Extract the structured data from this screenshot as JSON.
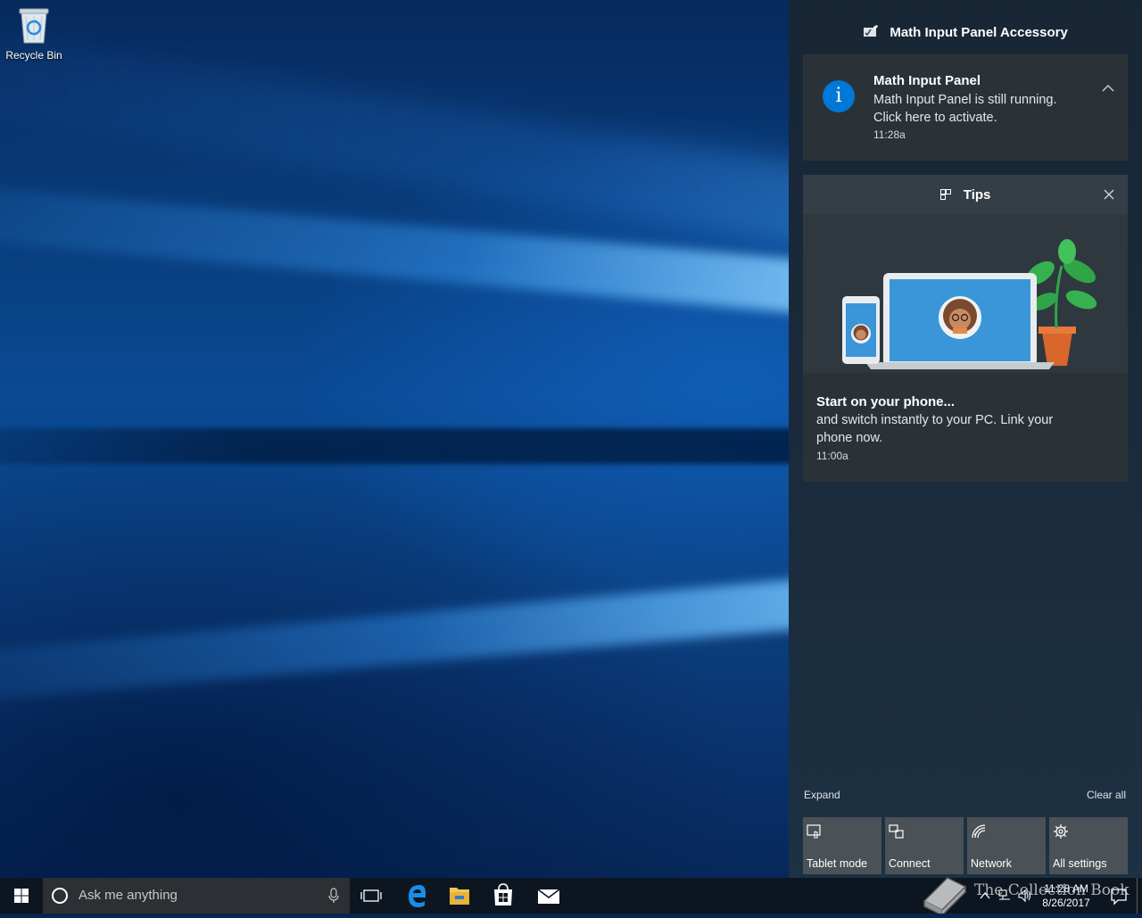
{
  "desktop": {
    "recycle_bin_label": "Recycle Bin"
  },
  "action_center": {
    "app_header": "Math Input Panel Accessory",
    "notification": {
      "title": "Math Input Panel",
      "body_line1": "Math Input Panel is still running.",
      "body_line2": "Click here to activate.",
      "time": "11:28a"
    },
    "tips": {
      "header": "Tips",
      "headline": "Start on your phone...",
      "body_line1": "and switch instantly to your PC. Link your",
      "body_line2": "phone now.",
      "time": "11:00a"
    },
    "expand_label": "Expand",
    "clear_all_label": "Clear all",
    "quick_actions": [
      {
        "label": "Tablet mode",
        "icon": "tablet-mode-icon"
      },
      {
        "label": "Connect",
        "icon": "connect-icon"
      },
      {
        "label": "Network",
        "icon": "network-icon"
      },
      {
        "label": "All settings",
        "icon": "gear-icon"
      }
    ]
  },
  "taskbar": {
    "search_placeholder": "Ask me anything",
    "clock_time": "11:28 AM",
    "clock_date": "8/26/2017",
    "pinned": [
      "task-view-icon",
      "edge-icon",
      "file-explorer-icon",
      "store-icon",
      "mail-icon"
    ]
  },
  "watermark_text": "The Collection Book",
  "colors": {
    "accent": "#0078d7",
    "card_bg": "#2b3237",
    "taskbar_bg": "#0d1620",
    "quick_action_bg": "#4a5157"
  }
}
